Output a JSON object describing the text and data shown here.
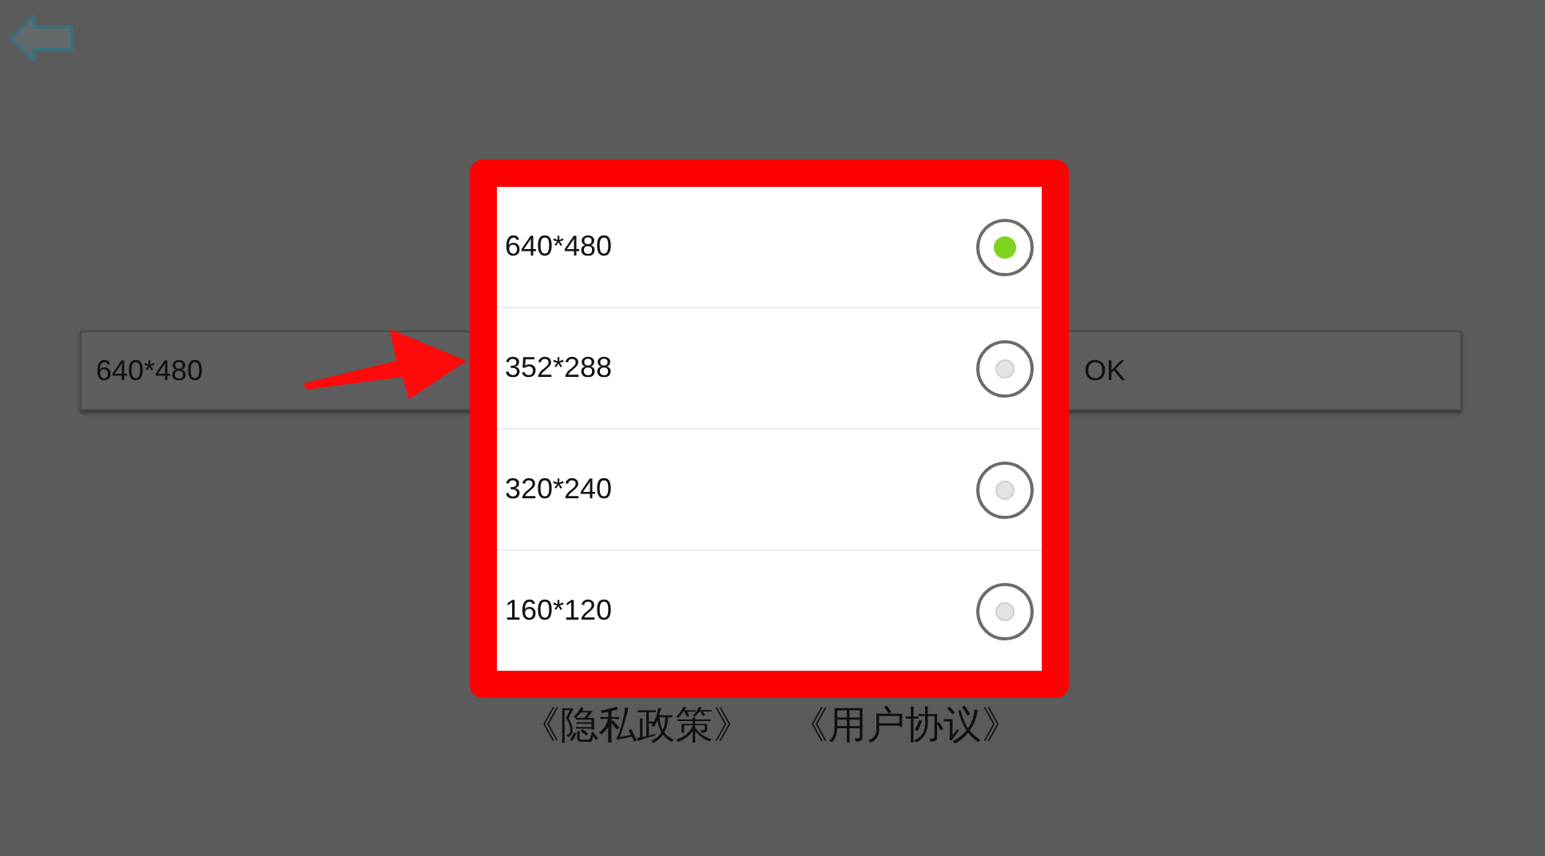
{
  "resolution_field": {
    "value": "640*480"
  },
  "ok_button": {
    "label": "OK"
  },
  "links": [
    "《隐私政策》",
    "《用户协议》"
  ],
  "dialog": {
    "options": [
      {
        "label": "640*480",
        "selected": true
      },
      {
        "label": "352*288",
        "selected": false
      },
      {
        "label": "320*240",
        "selected": false
      },
      {
        "label": "160*120",
        "selected": false
      }
    ]
  }
}
